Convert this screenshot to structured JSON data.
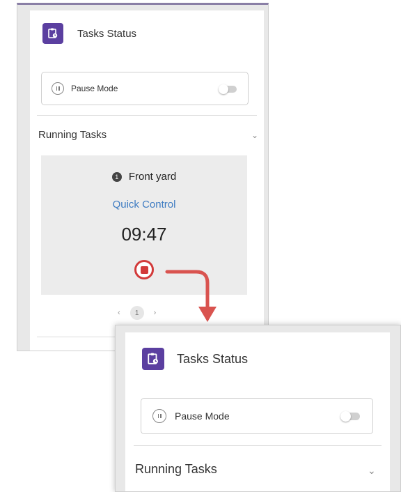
{
  "widget": {
    "title": "Tasks Status",
    "title_icon": "clipboard-clock-icon",
    "pause_label": "Pause Mode",
    "pause_icon": "pause-circle-icon",
    "pause_enabled": false,
    "section_title": "Running Tasks",
    "chevron": "⌄"
  },
  "task": {
    "badge": "1",
    "name": "Front yard",
    "link": "Quick Control",
    "timer": "09:47"
  },
  "pager": {
    "prev": "‹",
    "current": "1",
    "next": "›"
  },
  "colors": {
    "accent": "#5b3fa0",
    "link": "#3f7cc2",
    "stop": "#d23a3a",
    "arrow": "#d9534f"
  }
}
